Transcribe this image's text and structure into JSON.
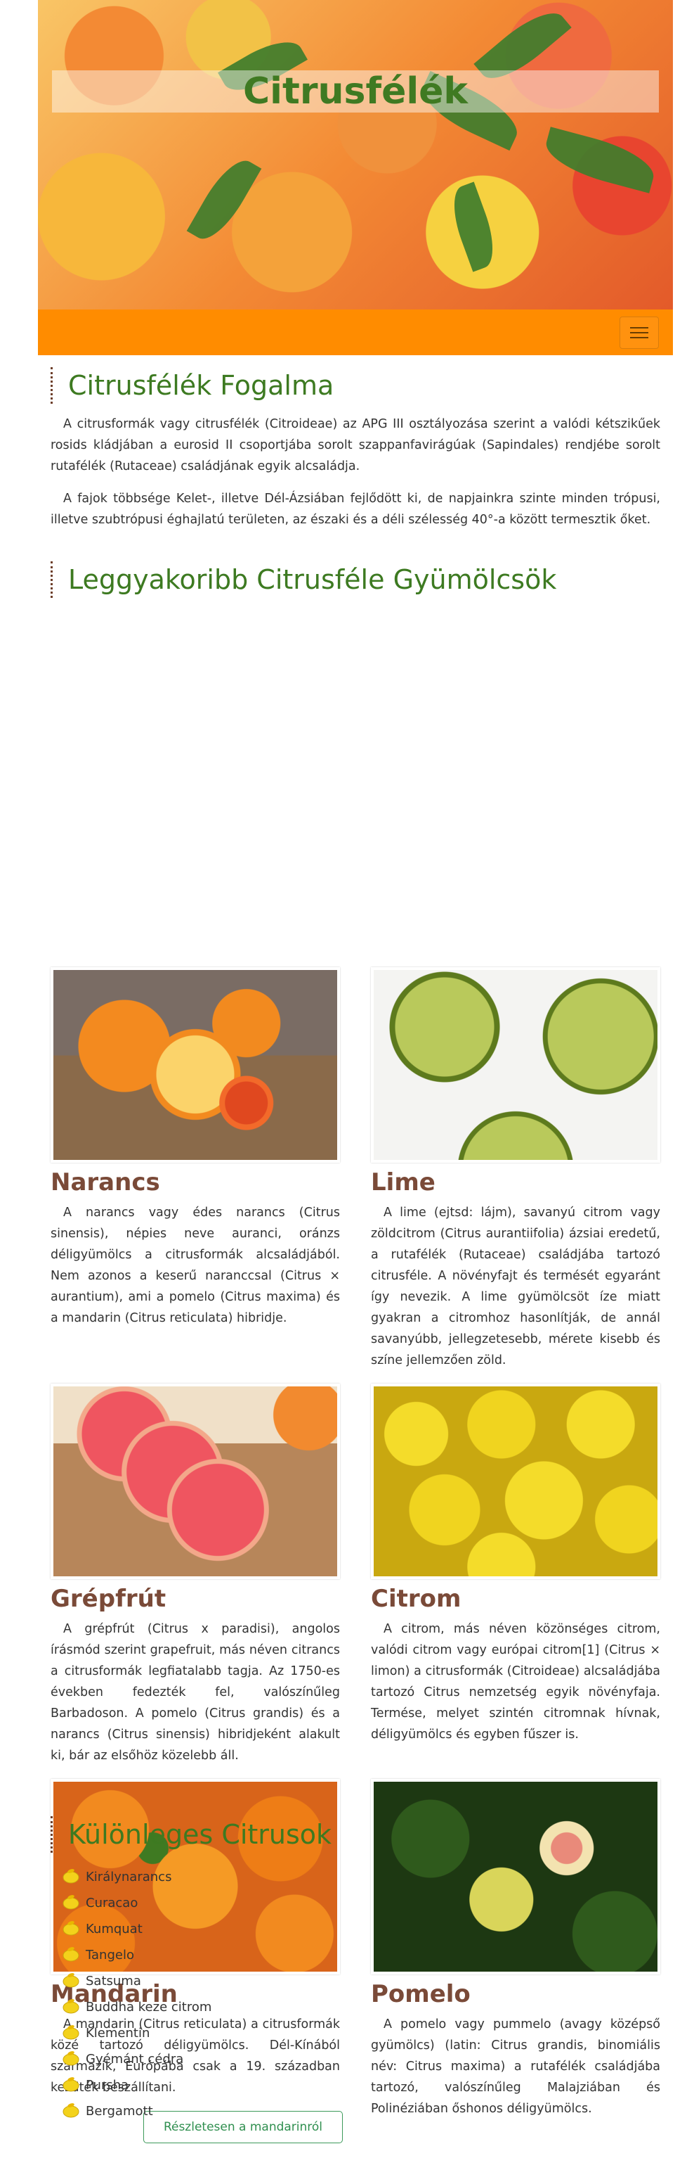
{
  "hero": {
    "title": "Citrusfélék"
  },
  "navbar": {
    "toggle_icon": "hamburger-icon",
    "accent": "#ff8c00"
  },
  "intro": {
    "title": "Citrusfélék Fogalma",
    "p1": "A citrusformák vagy citrusfélék (Citroideae) az APG III osztályozása szerint a valódi kétszikűek rosids kládjában a eurosid II csoportjába sorolt szappanfavirágúak (Sapindales) rendjébe sorolt rutafélék (Rutaceae) családjának egyik alcsaládja.",
    "p2": "A fajok többsége Kelet-, illetve Dél-Ázsiában fejlődött ki, de napjainkra szinte minden trópusi, illetve szubtrópusi éghajlatú területen, az északi és a déli szélesség 40°-a között termesztik őket."
  },
  "fruits": {
    "title": "Leggyakoribb Citrusféle Gyümölcsök",
    "items": [
      {
        "name": "Narancs",
        "desc": "A narancs vagy édes narancs (Citrus sinensis), népies neve auranci, oránzs déligyümölcs a citrusformák alcsaládjából. Nem azonos a keserű naranccsal (Citrus × aurantium), ami a pomelo (Citrus maxima) és a mandarin (Citrus reticulata) hibridje."
      },
      {
        "name": "Lime",
        "desc": "A lime (ejtsd: lájm), savanyú citrom vagy zöldcitrom (Citrus aurantiifolia) ázsiai eredetű, a rutafélék (Rutaceae) családjába tartozó citrusféle. A növényfajt és termését egyaránt így nevezik. A lime gyümölcsöt íze miatt gyakran a citromhoz hasonlítják, de annál savanyúbb, jellegzetesebb, mérete kisebb és színe jellemzően zöld."
      },
      {
        "name": "Grépfrút",
        "desc": "A grépfrút (Citrus x paradisi), angolos írásmód szerint grapefruit, más néven citrancs a citrusformák legfiatalabb tagja. Az 1750-es években fedezték fel, valószínűleg Barbadoson. A pomelo (Citrus grandis) és a narancs (Citrus sinensis) hibridjeként alakult ki, bár az elsőhöz közelebb áll."
      },
      {
        "name": "Citrom",
        "desc": "A citrom, más néven közönséges citrom, valódi citrom vagy európai citrom[1] (Citrus × limon) a citrusformák (Citroideae) alcsaládjába tartozó Citrus nemzetség egyik növényfaja. Termése, melyet szintén citromnak hívnak, déligyümölcs és egyben fűszer is."
      },
      {
        "name": "Mandarin",
        "desc": "A mandarin (Citrus reticulata) a citrusformák közé tartozó déligyümölcs. Dél-Kínából származik, Európába csak a 19. században kezdték beszállítani."
      },
      {
        "name": "Pomelo",
        "desc": "A pomelo vagy pummelo (avagy középső gyümölcs) (latin: Citrus grandis, binomiális név: Citrus maxima) a rutafélék családjába tartozó, valószínűleg Malajziában és Polinéziában őshonos déligyümölcs."
      }
    ],
    "mandarin_button": "Részletesen a mandarinról"
  },
  "special": {
    "title": "Különleges Citrusok",
    "bullet_icon": "lemon-icon",
    "items": [
      "Királynarancs",
      "Curacao",
      "Kumquat",
      "Tangelo",
      "Satsuma",
      "Buddha keze citrom",
      "Klementin",
      "Gyémánt cédra",
      "Pursha",
      "Bergamott"
    ]
  }
}
